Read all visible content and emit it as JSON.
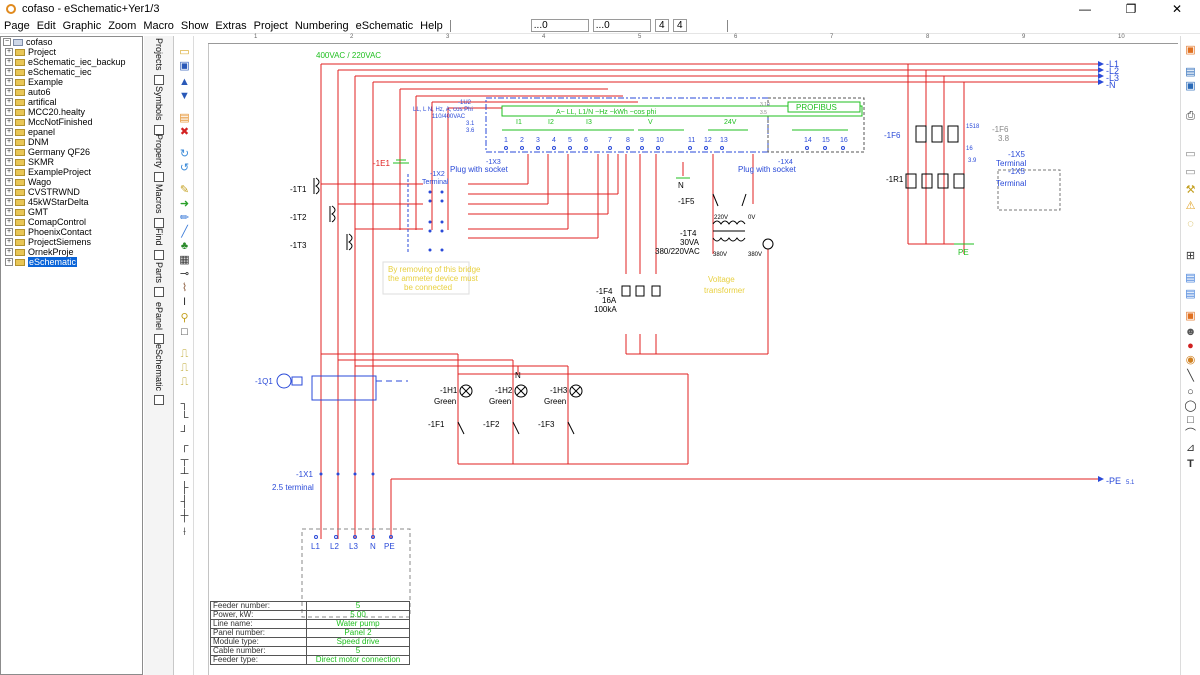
{
  "window": {
    "title": "cofaso - eSchematic+Yer1/3",
    "controls": {
      "minimize": "—",
      "maximize": "❐",
      "close": "✕"
    }
  },
  "menu": {
    "items": [
      "Page",
      "Edit",
      "Graphic",
      "Zoom",
      "Macro",
      "Show",
      "Extras",
      "Project",
      "Numbering",
      "eSchematic",
      "Help"
    ],
    "fields": [
      "...0",
      "...0",
      "4",
      "4"
    ]
  },
  "tree": {
    "items": [
      {
        "label": "cofaso",
        "root": true
      },
      {
        "label": "Project"
      },
      {
        "label": "eSchematic_iec_backup"
      },
      {
        "label": "eSchematic_iec"
      },
      {
        "label": "Example"
      },
      {
        "label": "auto6"
      },
      {
        "label": "artifical"
      },
      {
        "label": "MCC20.healty"
      },
      {
        "label": "MccNotFinished"
      },
      {
        "label": "epanel"
      },
      {
        "label": "DNM"
      },
      {
        "label": "Germany QF26"
      },
      {
        "label": "SKMR"
      },
      {
        "label": "ExampleProject"
      },
      {
        "label": "Wago"
      },
      {
        "label": "CVSTRWND"
      },
      {
        "label": "45kWStarDelta"
      },
      {
        "label": "GMT"
      },
      {
        "label": "ComapControl"
      },
      {
        "label": "PhoenixContact"
      },
      {
        "label": "ProjectSiemens"
      },
      {
        "label": "OrnekProje"
      },
      {
        "label": "eSchematic",
        "selected": true
      }
    ]
  },
  "vtabs": [
    "Projects",
    "Symbols",
    "Property",
    "Macros",
    "Find",
    "Parts",
    "ePanel",
    "eSchematic"
  ],
  "ruler": [
    "1",
    "2",
    "3",
    "4",
    "5",
    "6",
    "7",
    "8",
    "9",
    "10"
  ],
  "schematic": {
    "supply_label": "400VAC / 220VAC",
    "bus": [
      "-L1",
      "-L2",
      "-L3",
      "-N"
    ],
    "pe_label": "-PE",
    "pe_ref": "5.1",
    "u2_label": "-1U2",
    "u2_spec": "LL, L N, Hz, A, cos Phi",
    "u2_volt": "110/400VAC",
    "u2_pins": [
      "3.1",
      "3.6"
    ],
    "u2_header": "A~ LL, L1/N ~Hz ~kWh ~cos phi",
    "u2_groups": [
      "I1",
      "I2",
      "I3",
      "V",
      "24V"
    ],
    "profibus": "PROFIBUS",
    "profibus_ref": [
      "3.10",
      "3.5"
    ],
    "x3_label": "-1X3",
    "x3_nums": [
      "1",
      "2",
      "3",
      "4",
      "5",
      "6",
      "7",
      "8",
      "9",
      "10",
      "11",
      "12",
      "13"
    ],
    "x4_label": "-1X4",
    "x4_nums": [
      "14",
      "15",
      "16"
    ],
    "plug1": "Plug with socket",
    "plug2": "Plug with socket",
    "x2_label": "-1X2",
    "x2_sub": "Terminal",
    "e1": "-1E1",
    "ct": [
      "-1T1",
      "-1T2",
      "-1T3"
    ],
    "bridge_note": [
      "By removing of this bridge",
      "the ammeter device must",
      "be connected"
    ],
    "f5": "-1F5",
    "n_label": "N",
    "t4": [
      "-1T4",
      "30VA",
      "380/220VAC"
    ],
    "t4_pins": [
      "220V",
      "0V",
      "380V",
      "380V"
    ],
    "f4": [
      "-1F4",
      "16A",
      "100kA"
    ],
    "vt_note": [
      "Voltage",
      "transformer"
    ],
    "q1": "-1Q1",
    "lamps": [
      {
        "name": "-1H1",
        "color": "Green"
      },
      {
        "name": "-1H2",
        "color": "Green"
      },
      {
        "name": "-1H3",
        "color": "Green"
      }
    ],
    "fuses": [
      "-1F1",
      "-1F2",
      "-1F3"
    ],
    "x1": [
      "-1X1",
      "2.5 terminal"
    ],
    "motor_terms": [
      "L1",
      "L2",
      "L3",
      "N",
      "PE"
    ],
    "f6": "-1F6",
    "f6_ref": [
      "1518",
      "16"
    ],
    "f6b": [
      "-1F6",
      "3.8"
    ],
    "r1": "-1R1",
    "x5": [
      "-1X5",
      "Terminal",
      "-1X5",
      "Terminal"
    ],
    "pe_sym": "PE",
    "small_ref": "3.9"
  },
  "info": [
    {
      "key": "Feeder number:",
      "value": "5"
    },
    {
      "key": "Power, kW:",
      "value": "5.00"
    },
    {
      "key": "Line name:",
      "value": "Water pump"
    },
    {
      "key": "Panel number:",
      "value": "Panel 2"
    },
    {
      "key": "Module type:",
      "value": "Speed drive"
    },
    {
      "key": "Cable number:",
      "value": "5"
    },
    {
      "key": "Feeder type:",
      "value": "Direct motor connection"
    }
  ]
}
